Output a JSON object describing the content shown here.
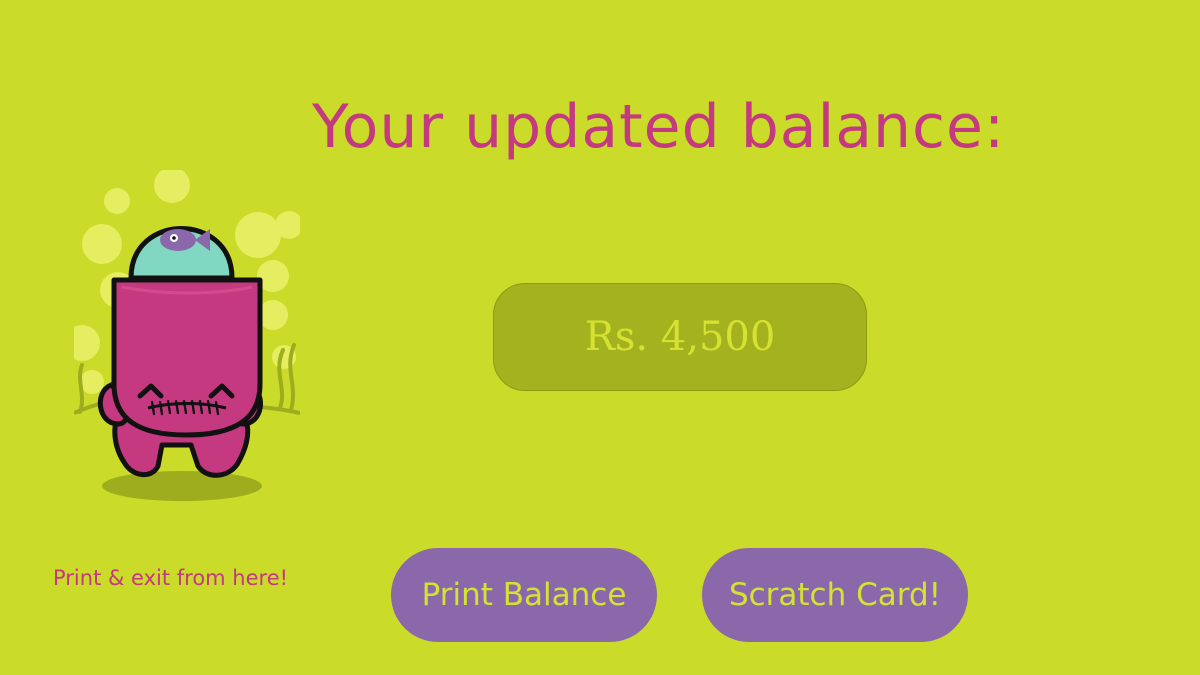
{
  "page": {
    "title": "Your updated balance:",
    "balance": "Rs. 4,500",
    "hint": "Print & exit from here!"
  },
  "actions": {
    "print_label": "Print Balance",
    "scratch_label": "Scratch Card!"
  },
  "mascot": {
    "icon": "pink-fishbowl-monster-icon",
    "fish_icon": "fish-icon"
  },
  "colors": {
    "background": "#cbdb29",
    "title": "#c4397f",
    "balance_box": "#a4b21f",
    "balance_text": "#d6e232",
    "button": "#8b68aa",
    "button_text": "#d6e232"
  }
}
